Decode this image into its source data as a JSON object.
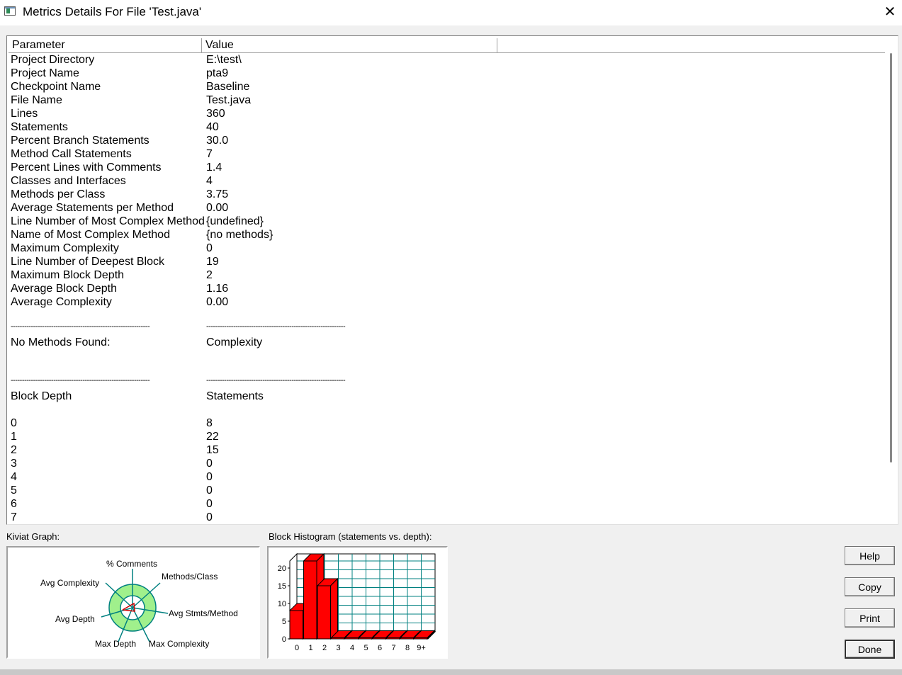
{
  "window": {
    "title": "Metrics Details For File 'Test.java'",
    "close_glyph": "✕"
  },
  "columns": [
    "Parameter",
    "Value"
  ],
  "rows": [
    [
      "Project Directory",
      "E:\\test\\"
    ],
    [
      "Project Name",
      "pta9"
    ],
    [
      "Checkpoint Name",
      "Baseline"
    ],
    [
      "File Name",
      "Test.java"
    ],
    [
      "Lines",
      "360"
    ],
    [
      "Statements",
      "40"
    ],
    [
      "Percent Branch Statements",
      "30.0"
    ],
    [
      "Method Call Statements",
      "7"
    ],
    [
      "Percent Lines with Comments",
      "1.4"
    ],
    [
      "Classes and Interfaces",
      "4"
    ],
    [
      "Methods per Class",
      "3.75"
    ],
    [
      "Average Statements per Method",
      "0.00"
    ],
    [
      "Line Number of Most Complex Method",
      "{undefined}"
    ],
    [
      "Name of Most Complex Method",
      "{no methods}"
    ],
    [
      "Maximum Complexity",
      "0"
    ],
    [
      "Line Number of Deepest Block",
      "19"
    ],
    [
      "Maximum Block Depth",
      "2"
    ],
    [
      "Average Block Depth",
      "1.16"
    ],
    [
      "Average Complexity",
      "0.00"
    ],
    [
      "",
      ""
    ],
    [
      "--------------------------------------------------------------",
      "--------------------------------------------------------------"
    ],
    [
      "No Methods Found:",
      "Complexity"
    ],
    [
      "",
      ""
    ],
    [
      "",
      ""
    ],
    [
      "--------------------------------------------------------------",
      "--------------------------------------------------------------"
    ],
    [
      "Block Depth",
      "Statements"
    ],
    [
      "",
      ""
    ],
    [
      "0",
      "8"
    ],
    [
      "1",
      "22"
    ],
    [
      "2",
      "15"
    ],
    [
      "3",
      "0"
    ],
    [
      "4",
      "0"
    ],
    [
      "5",
      "0"
    ],
    [
      "6",
      "0"
    ],
    [
      "7",
      "0"
    ]
  ],
  "kiviat": {
    "label": "Kiviat Graph:",
    "axes": [
      "% Comments",
      "Methods/Class",
      "Avg Stmts/Method",
      "Max Complexity",
      "Max Depth",
      "Avg Depth",
      "Avg Complexity"
    ],
    "colors": {
      "ring": "#a0f08c",
      "spoke": "#008080",
      "value": "#cc0000"
    }
  },
  "histogram": {
    "label": "Block Histogram (statements vs. depth):",
    "bar_color": "#ff0000",
    "grid_color": "#008080"
  },
  "chart_data": {
    "type": "bar",
    "title": "Block Histogram (statements vs. depth):",
    "categories": [
      "0",
      "1",
      "2",
      "3",
      "4",
      "5",
      "6",
      "7",
      "8",
      "9+"
    ],
    "values": [
      8,
      22,
      15,
      0,
      0,
      0,
      0,
      0,
      0,
      0
    ],
    "yticks": [
      "0",
      "5",
      "10",
      "15",
      "20"
    ],
    "ylim": [
      0,
      22
    ],
    "grid": true
  },
  "buttons": {
    "help": "Help",
    "copy": "Copy",
    "print": "Print",
    "done": "Done"
  }
}
